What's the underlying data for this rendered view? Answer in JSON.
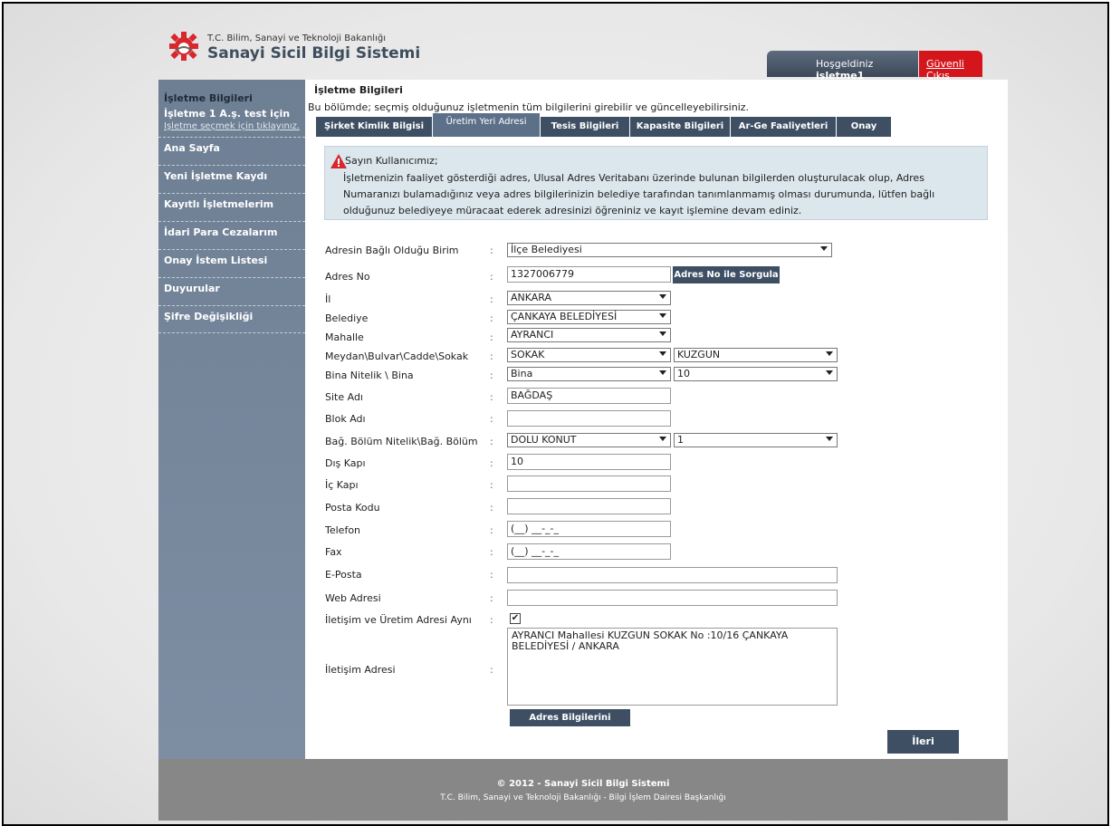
{
  "header": {
    "ministry": "T.C. Bilim, Sanayi ve Teknoloji Bakanlığı",
    "app_title": "Sanayi Sicil Bilgi Sistemi",
    "welcome_prefix": "Hoşgeldiniz",
    "username": "işletme1",
    "logout_label": "Güvenli Çıkış"
  },
  "sidebar": {
    "title": "İşletme Bilgileri",
    "company": "İşletme 1 A.ş. test için",
    "select_link": "İşletme seçmek için tıklayınız.",
    "items": [
      {
        "label": "Ana Sayfa"
      },
      {
        "label": "Yeni İşletme Kaydı"
      },
      {
        "label": "Kayıtlı İşletmelerim"
      },
      {
        "label": "İdari Para Cezalarım"
      },
      {
        "label": "Onay İstem Listesi"
      },
      {
        "label": "Duyurular"
      },
      {
        "label": "Şifre Değişikliği"
      }
    ]
  },
  "main": {
    "title": "İşletme Bilgileri",
    "description": "Bu bölümde; seçmiş olduğunuz işletmenin tüm bilgilerini girebilir ve güncelleyebilirsiniz.",
    "tabs": [
      {
        "label": "Şirket Kimlik Bilgisi"
      },
      {
        "label": "Üretim Yeri Adresi"
      },
      {
        "label": "Tesis Bilgileri"
      },
      {
        "label": "Kapasite Bilgileri"
      },
      {
        "label": "Ar-Ge Faaliyetleri"
      },
      {
        "label": "Onay"
      }
    ],
    "notice_title": "Sayın Kullanıcımız;",
    "notice_body": "İşletmenizin faaliyet gösterdiği adres, Ulusal Adres Veritabanı üzerinde bulunan bilgilerden oluşturulacak olup, Adres Numaranızı bulamadığınız veya adres bilgilerinizin belediye tarafından tanımlanmamış olması durumunda, lütfen bağlı olduğunuz belediyeye müracaat ederek adresinizi öğreniniz ve kayıt işlemine devam ediniz."
  },
  "form": {
    "birim_label": "Adresin Bağlı Olduğu Birim",
    "birim_value": "İlçe Belediyesi",
    "adres_no_label": "Adres No",
    "adres_no_value": "1327006779",
    "adres_no_button": "Adres No ile Sorgula",
    "il_label": "İl",
    "il_value": "ANKARA",
    "belediye_label": "Belediye",
    "belediye_value": "ÇANKAYA BELEDİYESİ",
    "mahalle_label": "Mahalle",
    "mahalle_value": "AYRANCI",
    "sokak_label": "Meydan\\Bulvar\\Cadde\\Sokak",
    "sokak_type_value": "SOKAK",
    "sokak_name_value": "KUZGUN",
    "bina_label": "Bina Nitelik \\ Bina",
    "bina_type_value": "Bina",
    "bina_no_value": "10",
    "site_label": "Site Adı",
    "site_value": "BAĞDAŞ",
    "blok_label": "Blok Adı",
    "blok_value": "",
    "bolum_label": "Bağ. Bölüm Nitelik\\Bağ. Bölüm",
    "bolum_type_value": "DOLU KONUT",
    "bolum_no_value": "1",
    "dis_kapi_label": "Dış Kapı",
    "dis_kapi_value": "10",
    "ic_kapi_label": "İç Kapı",
    "ic_kapi_value": "",
    "posta_label": "Posta Kodu",
    "posta_value": "",
    "telefon_label": "Telefon",
    "telefon_value": "(__) __-_-_",
    "fax_label": "Fax",
    "fax_value": "(__) __-_-_",
    "eposta_label": "E-Posta",
    "eposta_value": "",
    "web_label": "Web Adresi",
    "web_value": "",
    "ayni_label": "İletişim ve Üretim Adresi Aynı",
    "ayni_checked": "✔",
    "iletisim_label": "İletişim Adresi",
    "iletisim_value": "AYRANCI Mahallesi KUZGUN SOKAK No :10/16 ÇANKAYA BELEDİYESİ / ANKARA",
    "colon": ":",
    "save_button": "Adres Bilgilerini Kaydet",
    "next_button": "İleri"
  },
  "footer": {
    "copyright": "© 2012 - Sanayi Sicil Bilgi Sistemi",
    "org": "T.C. Bilim, Sanayi ve Teknoloji Bakanlığı - Bilgi İşlem Dairesi Başkanlığı"
  },
  "colors": {
    "sidebar": "#6e7f94",
    "tab": "#3e4f63",
    "logout": "#d4161c",
    "notice": "#dbe6ed"
  }
}
